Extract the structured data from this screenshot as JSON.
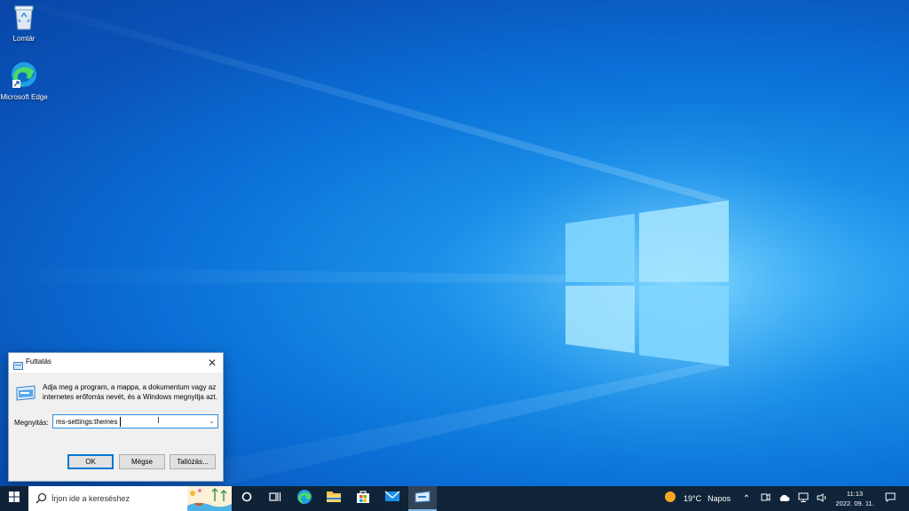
{
  "desktop": {
    "icons": [
      {
        "label": "Lomtár",
        "icon": "recycle-bin-icon"
      },
      {
        "label": "Microsoft Edge",
        "icon": "edge-icon"
      }
    ]
  },
  "run_dialog": {
    "title": "Futtatás",
    "description": "Adja meg a program, a mappa, a dokumentum vagy az internetes erőforrás nevét, és a Windows megnyitja azt.",
    "open_label": "Megnyitás:",
    "open_value": "ms-settings:themes",
    "ok_label": "OK",
    "cancel_label": "Mégse",
    "browse_label": "Tallózás..."
  },
  "taskbar": {
    "search_placeholder": "Írjon ide a kereséshez",
    "weather": {
      "temp": "19°C",
      "condition": "Napos"
    },
    "clock": {
      "time": "11:13",
      "date": "2022. 09. 11."
    }
  },
  "colors": {
    "accent": "#0078d7",
    "taskbar": "#102030"
  }
}
